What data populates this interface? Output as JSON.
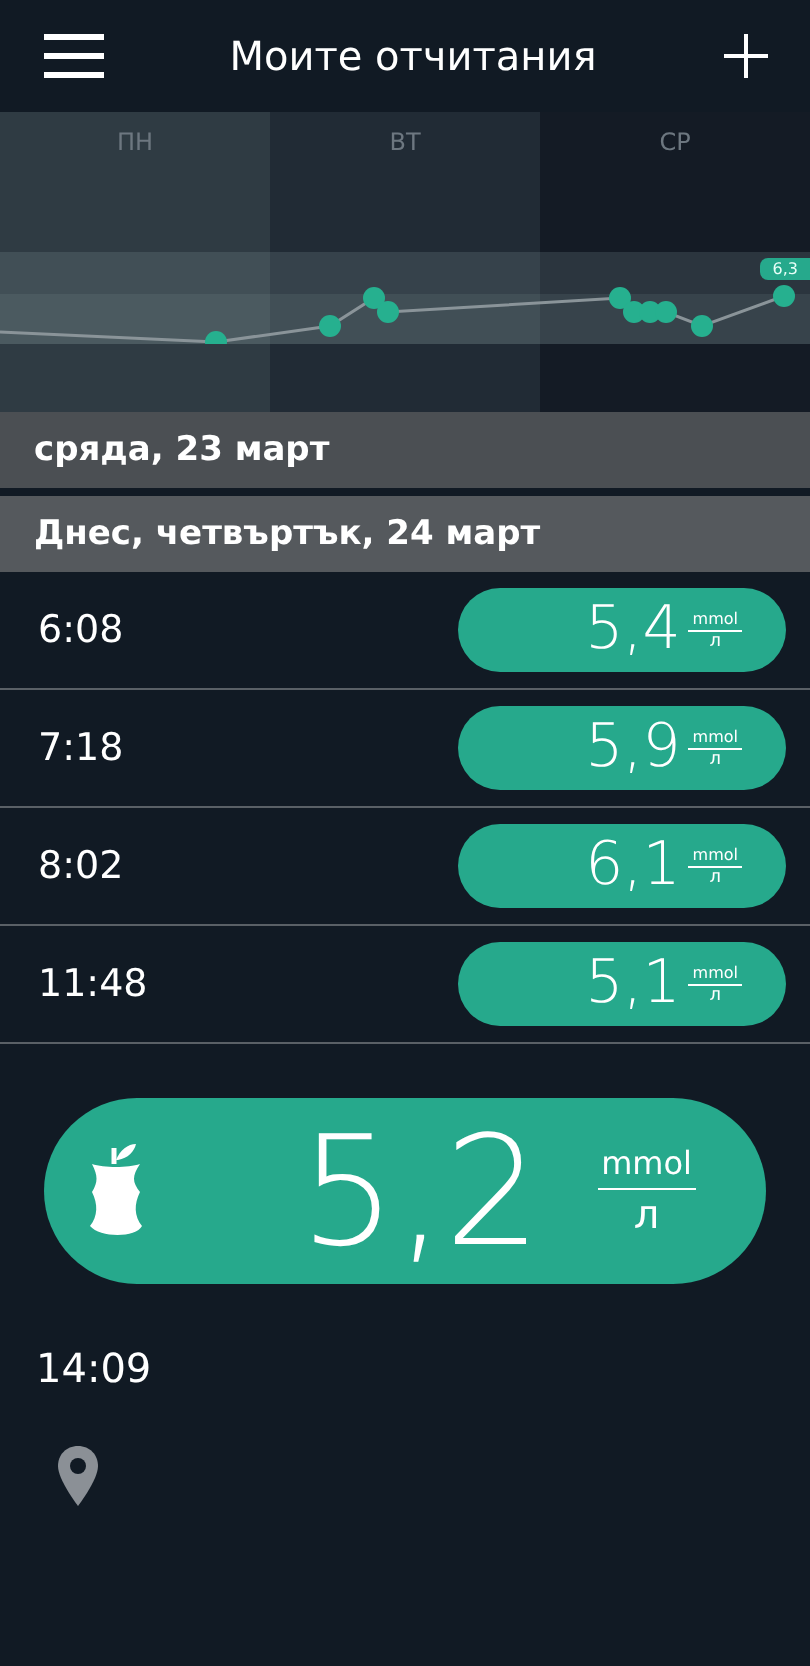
{
  "header": {
    "title": "Моите отчитания"
  },
  "chart": {
    "days": [
      {
        "label": "ПН"
      },
      {
        "label": "ВТ"
      },
      {
        "label": "СР"
      }
    ],
    "badge": "6,3"
  },
  "sections": [
    {
      "title": "сряда, 23 март",
      "today": false
    },
    {
      "title": "Днес, четвъртък, 24 март",
      "today": true,
      "readings": [
        {
          "time": "6:08",
          "value": "5,4",
          "unit_top": "mmol",
          "unit_bottom": "л"
        },
        {
          "time": "7:18",
          "value": "5,9",
          "unit_top": "mmol",
          "unit_bottom": "л"
        },
        {
          "time": "8:02",
          "value": "6,1",
          "unit_top": "mmol",
          "unit_bottom": "л"
        },
        {
          "time": "11:48",
          "value": "5,1",
          "unit_top": "mmol",
          "unit_bottom": "л"
        }
      ]
    }
  ],
  "current": {
    "value": "5,2",
    "unit_top": "mmol",
    "unit_bottom": "л",
    "time": "14:09",
    "meal": true,
    "location": true
  }
}
